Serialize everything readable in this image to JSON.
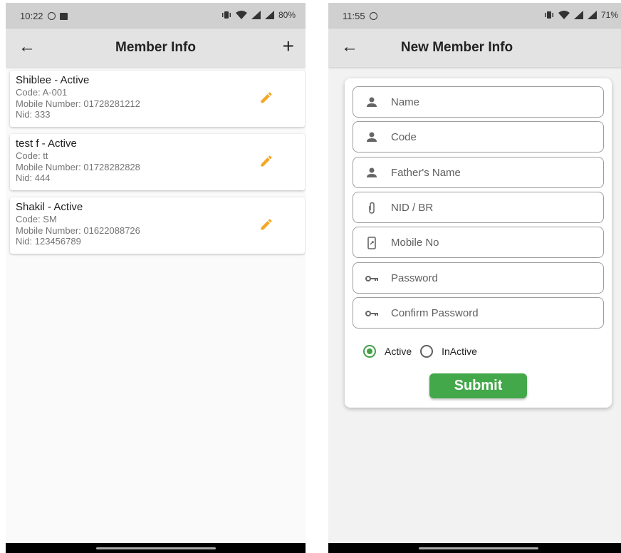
{
  "left": {
    "status": {
      "time": "10:22",
      "battery": "80%"
    },
    "appbar": {
      "back": "←",
      "title": "Member Info",
      "add": "+"
    },
    "members": [
      {
        "title": "Shiblee - Active",
        "code": "Code: A-001",
        "mobile": "Mobile Number: 01728281212",
        "nid": "Nid: 333"
      },
      {
        "title": "test f - Active",
        "code": "Code: tt",
        "mobile": "Mobile Number: 01728282828",
        "nid": "Nid: 444"
      },
      {
        "title": "Shakil - Active",
        "code": "Code: SM",
        "mobile": "Mobile Number: 01622088726",
        "nid": "Nid: 123456789"
      }
    ]
  },
  "right": {
    "status": {
      "time": "11:55",
      "battery": "71%"
    },
    "appbar": {
      "back": "←",
      "title": "New Member Info"
    },
    "form": {
      "fields": [
        {
          "placeholder": "Name",
          "icon": "person-icon"
        },
        {
          "placeholder": "Code",
          "icon": "person-icon"
        },
        {
          "placeholder": "Father's Name",
          "icon": "person-icon"
        },
        {
          "placeholder": "NID / BR",
          "icon": "attachment-icon"
        },
        {
          "placeholder": "Mobile No",
          "icon": "phone-icon"
        },
        {
          "placeholder": "Password",
          "icon": "key-icon"
        },
        {
          "placeholder": "Confirm Password",
          "icon": "key-icon"
        }
      ],
      "status_options": {
        "active": "Active",
        "inactive": "InActive",
        "selected": "Active"
      },
      "submit": "Submit"
    }
  },
  "colors": {
    "accent_green": "#43a84a",
    "edit_orange": "#f5a623",
    "appbar": "#e3e3e3",
    "statusbar": "#d0d0d0"
  }
}
